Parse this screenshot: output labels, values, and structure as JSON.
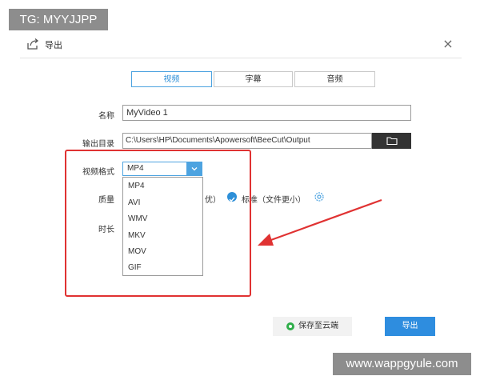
{
  "watermarks": {
    "top": "TG: MYYJJPP",
    "bottom": "www.wappgyule.com"
  },
  "header": {
    "title": "导出",
    "close_symbol": "×"
  },
  "tabs": [
    {
      "label": "视频",
      "active": true
    },
    {
      "label": "字幕",
      "active": false
    },
    {
      "label": "音频",
      "active": false
    }
  ],
  "form": {
    "name_label": "名称",
    "name_value": "MyVideo 1",
    "output_label": "输出目录",
    "output_path": "C:\\Users\\HP\\Documents\\Apowersoft\\BeeCut\\Output",
    "format_label": "视频格式",
    "format_value": "MP4",
    "quality_label": "质量",
    "quality_partial": "优）",
    "quality_selected": "标准（文件更小）",
    "duration_label": "时长"
  },
  "format_options": [
    "MP4",
    "AVI",
    "WMV",
    "MKV",
    "MOV",
    "GIF"
  ],
  "buttons": {
    "save_cloud": "保存至云端",
    "export": "导出"
  },
  "colors": {
    "accent": "#2e8ddf",
    "annotation": "#e03232",
    "folder_button": "#333333",
    "cloud_icon": "#2fae4a"
  },
  "icons": {
    "header": "export-icon",
    "close": "close-icon",
    "folder": "folder-icon",
    "dropdown": "chevron-down-icon",
    "check": "check-circle-icon",
    "settings": "gear-icon",
    "cloud": "cloud-save-icon",
    "annotation_arrow": "red-arrow-icon"
  }
}
